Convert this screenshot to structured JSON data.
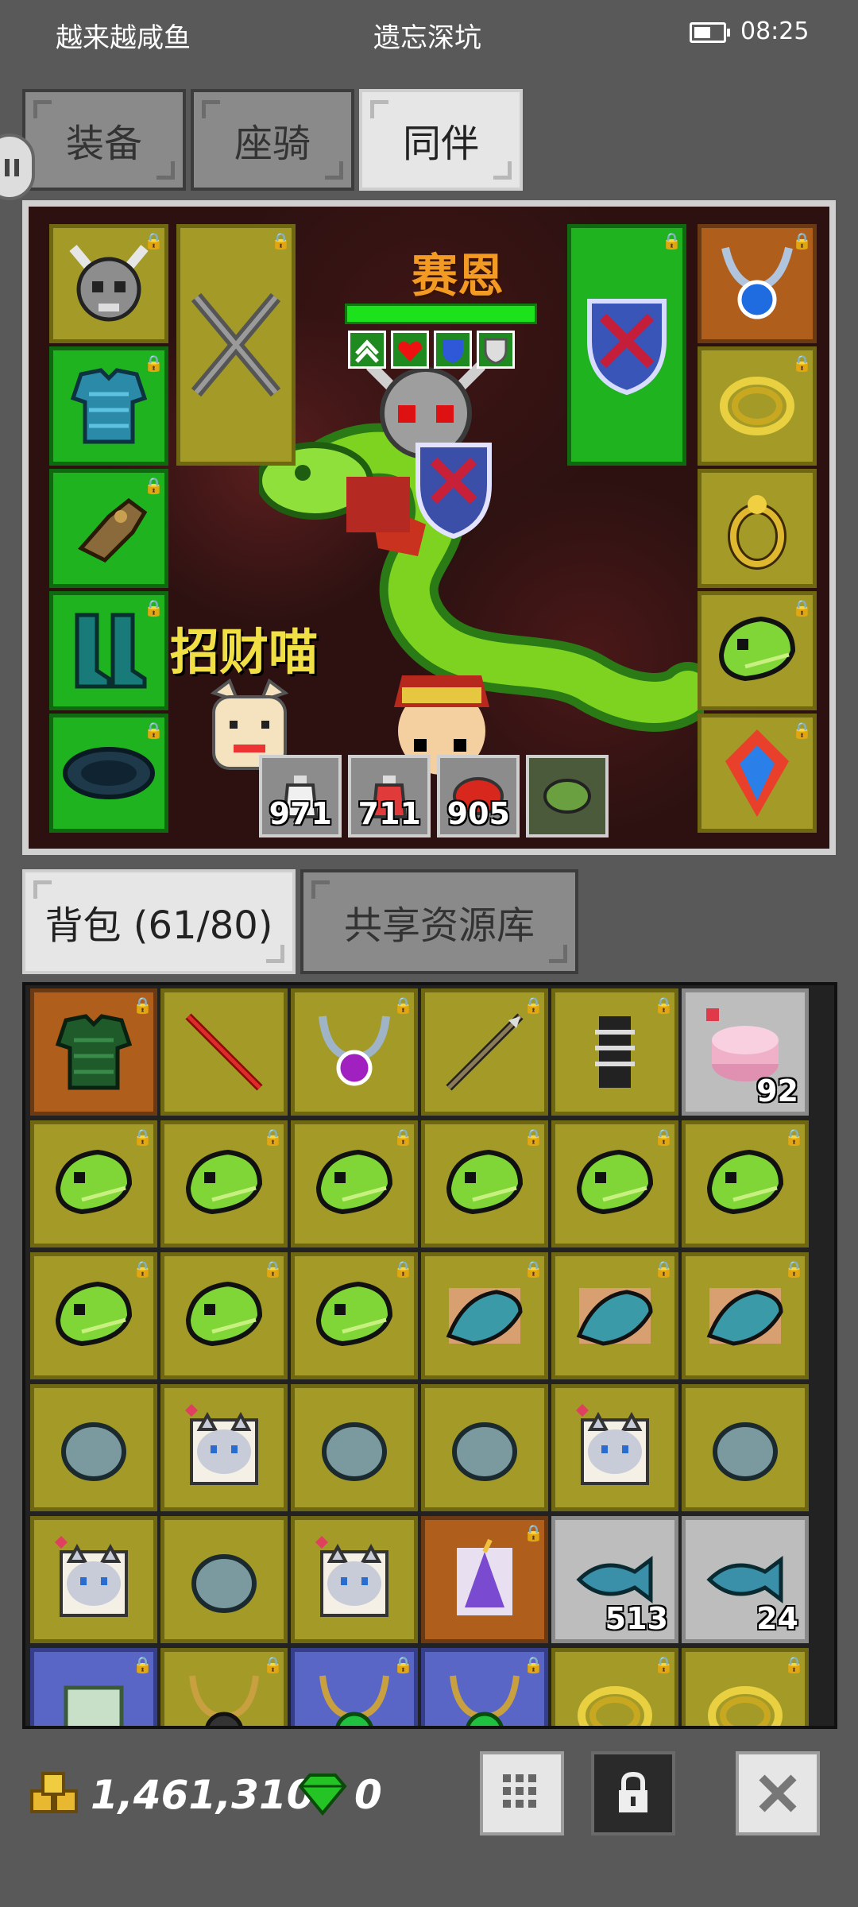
{
  "status_bar": {
    "left_text": "越来越咸鱼",
    "center_text": "遗忘深坑",
    "time": "08:25",
    "battery_icon": "battery-icon"
  },
  "tabs": [
    {
      "label": "装备",
      "active": false
    },
    {
      "label": "座骑",
      "active": false
    },
    {
      "label": "同伴",
      "active": true
    }
  ],
  "companion": {
    "name": "赛恩",
    "hp_fraction": 1.0,
    "buff_icons": [
      "rank-up-icon",
      "heart-plus-icon",
      "shield-blue-plus-icon",
      "shield-plus-icon"
    ],
    "pet_name": "招财喵",
    "left_slots": [
      {
        "icon": "horned-skull-helmet-icon",
        "color": "yellow",
        "locked": true
      },
      {
        "icon": "blue-chainmail-armor-icon",
        "color": "green",
        "locked": true
      },
      {
        "icon": "leather-gauntlet-icon",
        "color": "green",
        "locked": true
      },
      {
        "icon": "teal-boots-icon",
        "color": "green",
        "locked": true
      },
      {
        "icon": "dark-belt-icon",
        "color": "green",
        "locked": true
      }
    ],
    "weapon_slot": {
      "icon": "crossed-swords-icon",
      "color": "yellow",
      "locked": true
    },
    "offhand_slot": {
      "icon": "blue-shield-icon",
      "color": "green",
      "locked": true
    },
    "right_slots": [
      {
        "icon": "blue-gem-amulet-icon",
        "color": "orange",
        "locked": true
      },
      {
        "icon": "gold-ring-coil-icon",
        "color": "yellow",
        "locked": true
      },
      {
        "icon": "gold-ring-icon",
        "color": "yellow",
        "locked": true
      },
      {
        "icon": "snake-head-icon",
        "color": "yellow",
        "locked": true
      },
      {
        "icon": "fire-ice-crystal-icon",
        "color": "yellow",
        "locked": true
      }
    ],
    "consumables": [
      {
        "icon": "white-potion-icon",
        "count": "971"
      },
      {
        "icon": "red-potion-icon",
        "count": "711"
      },
      {
        "icon": "red-meat-icon",
        "count": "905"
      },
      {
        "icon": "snake-portrait-icon",
        "count": ""
      }
    ]
  },
  "bag_tabs": [
    {
      "label": "背包 (61/80)",
      "active": true
    },
    {
      "label": "共享资源库",
      "active": false
    }
  ],
  "bag_items": [
    {
      "icon": "green-armor-icon",
      "color": "orange",
      "locked": true,
      "count": ""
    },
    {
      "icon": "red-spear-icon",
      "color": "yellow",
      "locked": false,
      "count": ""
    },
    {
      "icon": "purple-gem-necklace-icon",
      "color": "yellow",
      "locked": true,
      "count": ""
    },
    {
      "icon": "long-spear-icon",
      "color": "yellow",
      "locked": true,
      "count": ""
    },
    {
      "icon": "skeleton-armor-icon",
      "color": "yellow",
      "locked": true,
      "count": ""
    },
    {
      "icon": "pink-cake-icon",
      "color": "gray",
      "locked": false,
      "count": "92"
    },
    {
      "icon": "snake-head-icon",
      "color": "yellow",
      "locked": true,
      "count": ""
    },
    {
      "icon": "snake-head-icon",
      "color": "yellow",
      "locked": true,
      "count": ""
    },
    {
      "icon": "snake-head-icon",
      "color": "yellow",
      "locked": true,
      "count": ""
    },
    {
      "icon": "snake-head-icon",
      "color": "yellow",
      "locked": true,
      "count": ""
    },
    {
      "icon": "snake-head-icon",
      "color": "yellow",
      "locked": true,
      "count": ""
    },
    {
      "icon": "snake-head-icon",
      "color": "yellow",
      "locked": true,
      "count": ""
    },
    {
      "icon": "snake-head-icon",
      "color": "yellow",
      "locked": true,
      "count": ""
    },
    {
      "icon": "snake-head-icon",
      "color": "yellow",
      "locked": true,
      "count": ""
    },
    {
      "icon": "snake-head-icon",
      "color": "yellow",
      "locked": true,
      "count": ""
    },
    {
      "icon": "teal-lizard-icon",
      "color": "yellow",
      "locked": true,
      "count": ""
    },
    {
      "icon": "teal-lizard-icon",
      "color": "yellow",
      "locked": true,
      "count": ""
    },
    {
      "icon": "teal-lizard-icon",
      "color": "yellow",
      "locked": true,
      "count": ""
    },
    {
      "icon": "gray-stone-icon",
      "color": "yellow",
      "locked": false,
      "count": ""
    },
    {
      "icon": "cat-portrait-icon",
      "color": "yellow",
      "locked": false,
      "count": ""
    },
    {
      "icon": "gray-stone-icon",
      "color": "yellow",
      "locked": false,
      "count": ""
    },
    {
      "icon": "gray-stone-icon",
      "color": "yellow",
      "locked": false,
      "count": ""
    },
    {
      "icon": "cat-portrait-icon",
      "color": "yellow",
      "locked": false,
      "count": ""
    },
    {
      "icon": "gray-stone-icon",
      "color": "yellow",
      "locked": false,
      "count": ""
    },
    {
      "icon": "cat-portrait-icon",
      "color": "yellow",
      "locked": false,
      "count": ""
    },
    {
      "icon": "gray-stone-icon",
      "color": "yellow",
      "locked": false,
      "count": ""
    },
    {
      "icon": "cat-portrait-icon",
      "color": "yellow",
      "locked": false,
      "count": ""
    },
    {
      "icon": "unicorn-knight-icon",
      "color": "orange",
      "locked": true,
      "count": ""
    },
    {
      "icon": "blue-fish-icon",
      "color": "gray",
      "locked": false,
      "count": "513"
    },
    {
      "icon": "blue-fish-icon",
      "color": "gray",
      "locked": false,
      "count": "24"
    },
    {
      "icon": "scroll-icon",
      "color": "blue",
      "locked": true,
      "count": ""
    },
    {
      "icon": "dark-orb-amulet-icon",
      "color": "yellow",
      "locked": true,
      "count": ""
    },
    {
      "icon": "green-gem-amulet-icon",
      "color": "blue",
      "locked": true,
      "count": ""
    },
    {
      "icon": "green-gem-amulet-icon",
      "color": "blue",
      "locked": true,
      "count": ""
    },
    {
      "icon": "gold-ring-coil-icon",
      "color": "yellow",
      "locked": true,
      "count": ""
    },
    {
      "icon": "gold-ring-coil-icon",
      "color": "yellow",
      "locked": true,
      "count": ""
    }
  ],
  "currency": {
    "gold_icon": "gold-coins-icon",
    "gold": "1,461,310",
    "gem_icon": "green-gem-icon",
    "gems": "0"
  },
  "buttons": {
    "sort_icon": "grid-sort-icon",
    "lock_icon": "lock-icon",
    "close_icon": "close-icon"
  },
  "colors": {
    "slot_green": "#1fb31f",
    "slot_yellow": "#a39a28",
    "slot_orange": "#b05e1c",
    "slot_gray": "#bdbdbd",
    "slot_blue": "#5a66c6",
    "hero_name": "#f39a22",
    "pet_name": "#f0e045"
  }
}
